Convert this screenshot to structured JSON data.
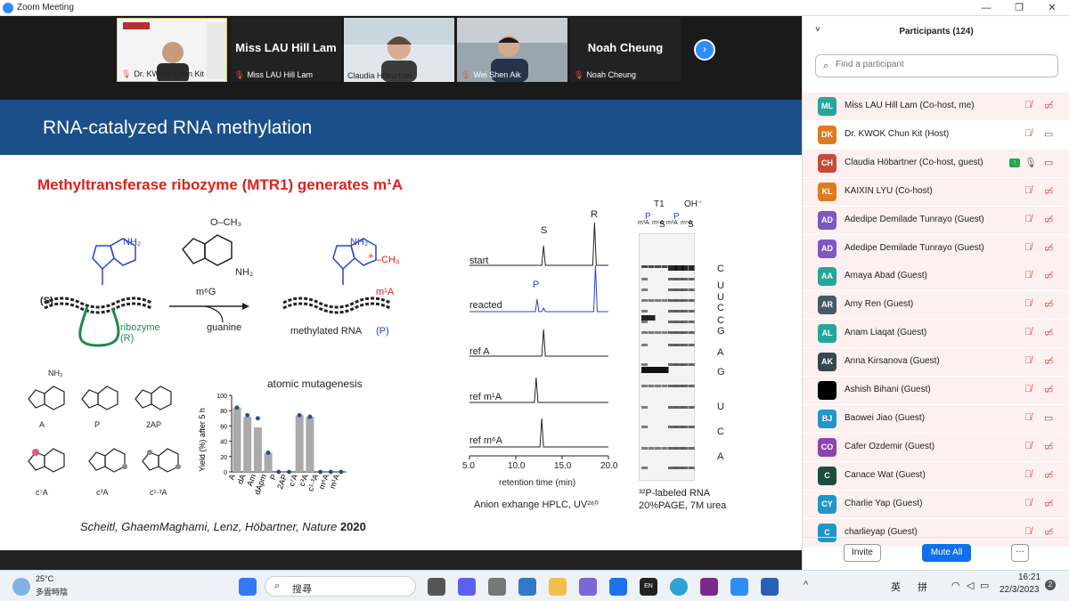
{
  "window": {
    "title": "Zoom Meeting",
    "min": "—",
    "restore": "❐",
    "close": "✕"
  },
  "video_strip": {
    "tiles": [
      {
        "name": "Dr. KWOK Chun Kit",
        "pinned": true
      },
      {
        "name": "Miss LAU Hill Lam",
        "display": "Miss LAU Hill Lam"
      },
      {
        "name": "Claudia Höbartner"
      },
      {
        "name": "Wei Shen Aik"
      },
      {
        "name": "Noah Cheung",
        "display": "Noah Cheung"
      }
    ],
    "next_icon": "›"
  },
  "slide": {
    "title": "RNA-catalyzed RNA methylation",
    "subtitle": "Methyltransferase ribozyme (MTR1) generates m¹A",
    "scheme": {
      "s_label": "(S)",
      "ribozyme": "ribozyme",
      "r": "(R)",
      "m6g": "m⁶G",
      "guanine": "guanine",
      "methylated": "methylated RNA",
      "p": "(P)",
      "nh2": "NH₂",
      "och3": "O–CH₃",
      "ch3": "–CH₃",
      "m1a": "m¹A",
      "plus": "+"
    },
    "analogs": [
      {
        "label": "A"
      },
      {
        "label": "P"
      },
      {
        "label": "2AP"
      },
      {
        "label": "c⁷A"
      },
      {
        "label": "c³A"
      },
      {
        "label": "c¹·³A"
      }
    ],
    "nh2": "NH₂",
    "hplc_rows": [
      "start",
      "reacted",
      "ref A",
      "ref m¹A",
      "ref m⁶A"
    ],
    "hplc_peak_labels": {
      "s": "S",
      "r": "R",
      "p": "P"
    },
    "hplc_axis": {
      "ticks": [
        "5.0",
        "10.0",
        "15.0",
        "20.0"
      ],
      "label": "retention time (min)"
    },
    "hplc_caption": "Anion exhange HPLC, UV²⁶⁰",
    "gel": {
      "top": [
        "T1",
        "OH⁻"
      ],
      "lanes": [
        "m¹A",
        "P",
        "m⁶A",
        "S",
        "m¹A",
        "P",
        "m⁶A",
        "S"
      ],
      "right_labels": [
        "C",
        "U",
        "U",
        "C",
        "C",
        "G",
        "A",
        "G",
        "U",
        "C",
        "A"
      ],
      "caption1": "³²P-labeled RNA",
      "caption2": "20%PAGE, 7M urea"
    },
    "citation_italic": "Scheitl, GhaemMaghami, Lenz, Höbartner, Nature ",
    "citation_year": "2020"
  },
  "chart_data": {
    "type": "bar",
    "title": "atomic mutagenesis",
    "ylabel": "Yield (%) after 5 h",
    "xlabel": "",
    "ylim": [
      0,
      100
    ],
    "yticks": [
      "0",
      "20",
      "40",
      "60",
      "80",
      "100"
    ],
    "categories": [
      "A",
      "dA",
      "Am",
      "dApm",
      "P",
      "2AP",
      "c⁷A",
      "c³A",
      "c¹·³A",
      "m⁶A",
      "m¹A"
    ],
    "values": [
      84,
      72,
      58,
      25,
      0,
      0,
      74,
      72,
      0,
      0,
      0
    ],
    "points": [
      84,
      74,
      70,
      25,
      0,
      0,
      74,
      72,
      0,
      0,
      0
    ],
    "grid": false,
    "bar_color": "#aaaaaa",
    "point_color": "#1f4f88"
  },
  "panel": {
    "title": "Participants (124)",
    "chevron": "˅",
    "search_placeholder": "Find a participant",
    "participants": [
      {
        "initials": "ML",
        "name": "Miss LAU Hill Lam (Co-host, me)",
        "color": "#26a69a",
        "muted": true,
        "video_off": true
      },
      {
        "initials": "DK",
        "name": "Dr. KWOK Chun Kit (Host)",
        "color": "#e07a1f",
        "muted": true,
        "video_off": false
      },
      {
        "initials": "CH",
        "name": "Claudia Höbartner (Co-host, guest)",
        "color": "#c94a3a",
        "muted": false,
        "video_off": false,
        "sharing": true
      },
      {
        "initials": "KL",
        "name": "KAIXIN LYU (Co-host)",
        "color": "#e07a1f",
        "muted": true,
        "video_off": true
      },
      {
        "initials": "AD",
        "name": "Adedipe Demilade Tunrayo (Guest)",
        "color": "#7e57c2",
        "muted": true,
        "video_off": true
      },
      {
        "initials": "AD",
        "name": "Adedipe Demilade Tunrayo (Guest)",
        "color": "#7e57c2",
        "muted": true,
        "video_off": true
      },
      {
        "initials": "AA",
        "name": "Amaya Abad (Guest)",
        "color": "#26a69a",
        "muted": true,
        "video_off": true
      },
      {
        "initials": "AR",
        "name": "Amy Ren (Guest)",
        "color": "#455a64",
        "muted": true,
        "video_off": true
      },
      {
        "initials": "AL",
        "name": "Anam Liaqat (Guest)",
        "color": "#26a69a",
        "muted": true,
        "video_off": true
      },
      {
        "initials": "AK",
        "name": "Anna Kirsanova (Guest)",
        "color": "#37474f",
        "muted": true,
        "video_off": true
      },
      {
        "initials": "",
        "name": "Ashish Bihani (Guest)",
        "color": "#000000",
        "muted": true,
        "video_off": true
      },
      {
        "initials": "BJ",
        "name": "Baowei Jiao (Guest)",
        "color": "#2196c8",
        "muted": true,
        "video_off": false
      },
      {
        "initials": "CO",
        "name": "Cafer Ozdemir (Guest)",
        "color": "#8e44ad",
        "muted": true,
        "video_off": true
      },
      {
        "initials": "C",
        "name": "Canace Wat (Guest)",
        "color": "#1b4d3e",
        "muted": true,
        "video_off": true
      },
      {
        "initials": "CY",
        "name": "Charlie Yap (Guest)",
        "color": "#2196c8",
        "muted": true,
        "video_off": true
      },
      {
        "initials": "C",
        "name": "charlieyap (Guest)",
        "color": "#2196c8",
        "muted": true,
        "video_off": true
      }
    ],
    "invite": "Invite",
    "mute_all": "Mute All",
    "more": "···"
  },
  "taskbar": {
    "weather_temp": "25°C",
    "weather_desc": "多雲時陰",
    "search": "搜尋",
    "lang_en": "EN",
    "ime1": "英",
    "ime2": "拼",
    "time": "16:21",
    "date": "22/3/2023",
    "badge": "2",
    "caret": "^"
  }
}
